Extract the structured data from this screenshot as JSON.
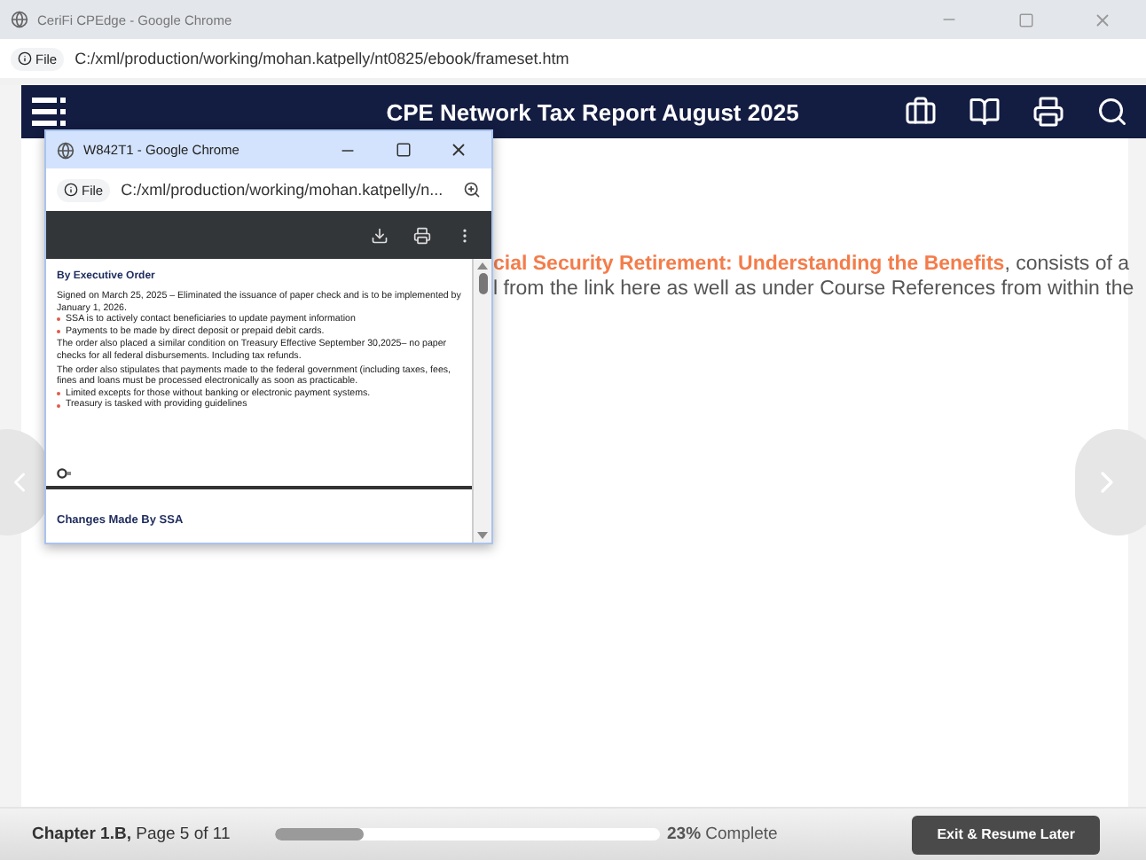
{
  "window": {
    "title": "CeriFi CPEdge - Google Chrome",
    "url_label": "File",
    "url": "C:/xml/production/working/mohan.katpelly/nt0825/ebook/frameset.htm"
  },
  "header": {
    "title": "CPE Network Tax Report August 2025"
  },
  "content": {
    "link": "cial Security Retirement: Understanding the Benefits",
    "after_link": ", consists of a",
    "line_2": "l from the link here as well as under Course References from within the"
  },
  "popup": {
    "title": "W842T1 - Google Chrome",
    "url_label": "File",
    "url": "C:/xml/production/working/mohan.katpelly/n...",
    "document": {
      "heading": "By Executive Order",
      "blocks": [
        {
          "kind": "paragraph",
          "text": "Signed on March 25, 2025 – Eliminated the issuance of paper check and is to be implemented by January 1, 2026."
        },
        {
          "kind": "bullet",
          "text": "SSA is to actively contact beneficiaries to update payment information"
        },
        {
          "kind": "bullet",
          "text": "Payments to be made by direct deposit or prepaid debit cards."
        },
        {
          "kind": "paragraph",
          "text": "The order also placed a similar condition on Treasury Effective September 30,2025– no paper checks for all federal disbursements. Including tax refunds."
        },
        {
          "kind": "paragraph",
          "text": "The order also stipulates that payments made to the federal government (including taxes, fees, fines and loans must be processed electronically as soon as practicable."
        },
        {
          "kind": "bullet",
          "text": "Limited excepts for those without banking or electronic payment systems."
        },
        {
          "kind": "bullet",
          "text": "Treasury is tasked with providing guidelines"
        }
      ],
      "next_heading": "Changes Made By SSA"
    }
  },
  "footer": {
    "chapter": "Chapter 1.B,",
    "page": "Page 5 of 11",
    "progress": {
      "level": 0.23
    },
    "percent": "23%",
    "complete_label": "Complete",
    "exit_button": "Exit & Resume Later"
  }
}
